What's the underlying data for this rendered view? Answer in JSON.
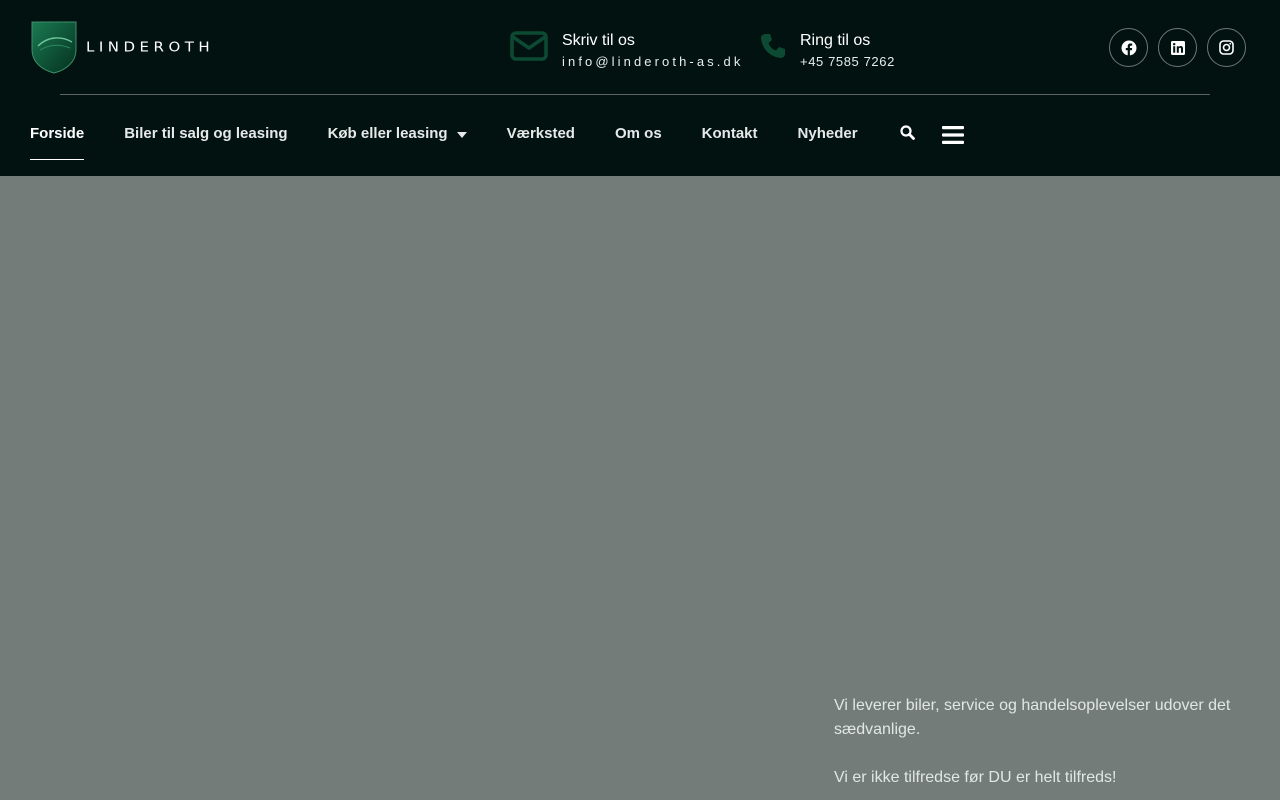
{
  "brand": {
    "name": "LINDEROTH",
    "accent": "#0d4a33",
    "header_bg": "#011210",
    "hero_bg": "#737c79"
  },
  "contact": {
    "email": {
      "icon": "envelope-icon",
      "title": "Skriv til os",
      "value": "info@linderoth-as.dk"
    },
    "phone": {
      "icon": "phone-icon",
      "title": "Ring til os",
      "value": "+45 7585 7262"
    }
  },
  "socials": [
    {
      "icon": "facebook-icon"
    },
    {
      "icon": "linkedin-icon"
    },
    {
      "icon": "instagram-icon"
    }
  ],
  "nav": {
    "items": [
      {
        "label": "Forside",
        "active": true
      },
      {
        "label": "Biler til salg og leasing"
      },
      {
        "label": "Køb eller leasing",
        "dropdown": true
      },
      {
        "label": "Værksted"
      },
      {
        "label": "Om os"
      },
      {
        "label": "Kontakt"
      },
      {
        "label": "Nyheder"
      }
    ],
    "search_icon": "search-icon",
    "menu_icon": "hamburger-menu-icon"
  },
  "hero": {
    "line1": "Vi leverer biler, service og handelsoplevelser udover det sædvanlige.",
    "line2": "Vi er ikke tilfredse før DU er helt tilfreds!"
  }
}
